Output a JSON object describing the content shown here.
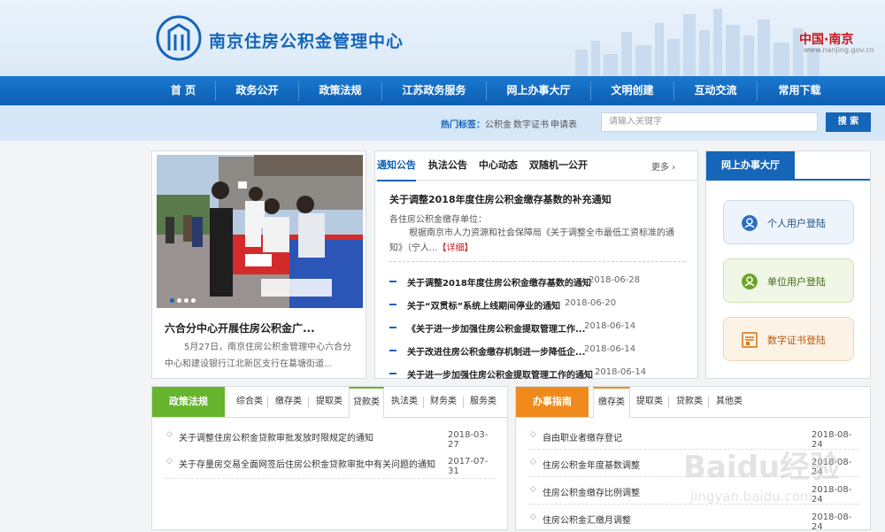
{
  "header": {
    "site_title": "南京住房公积金管理中心",
    "china_nanjing": "中国·南京",
    "nanjing_url": "www.nanjing.gov.cn"
  },
  "nav": {
    "items": [
      "首 页",
      "政务公开",
      "政策法规",
      "江苏政务服务",
      "网上办事大厅",
      "文明创建",
      "互动交流",
      "常用下载"
    ]
  },
  "search": {
    "hot_label": "热门标签：",
    "tags": [
      "公积金",
      "数字证书",
      "申请表"
    ],
    "placeholder": "请输入关键字",
    "button": "搜 索"
  },
  "carousel": {
    "headline": "六合分中心开展住房公积金广...",
    "summary": "5月27日，南京住房公积金管理中心六合分中心和建设银行江北新区支行在葛塘街道...",
    "active_slide": 1,
    "slide_count": 4
  },
  "notice": {
    "tabs": [
      "通知公告",
      "执法公告",
      "中心动态",
      "双随机一公开"
    ],
    "more": "更多 ›",
    "main_title": "关于调整2018年度住房公积金缴存基数的补充通知",
    "main_to": "各住房公积金缴存单位：",
    "main_body": "根据南京市人力资源和社会保障局《关于调整全市最低工资标准的通知》（宁人...",
    "detail": "【详细】",
    "items": [
      {
        "title": "关于调整2018年度住房公积金缴存基数的通知",
        "date": "2018-06-28"
      },
      {
        "title": "关于“双贯标”系统上线期间停业的通知",
        "date": "2018-06-20"
      },
      {
        "title": "《关于进一步加强住房公积金提取管理工作...",
        "date": "2018-06-14"
      },
      {
        "title": "关于改进住房公积金缴存机制进一步降低企...",
        "date": "2018-06-14"
      },
      {
        "title": "关于进一步加强住房公积金提取管理工作的通知",
        "date": "2018-06-14"
      }
    ]
  },
  "hall": {
    "header": "网上办事大厅",
    "buttons": [
      "个人用户登陆",
      "单位用户登陆",
      "数字证书登陆"
    ]
  },
  "policy": {
    "label": "政策法规",
    "tabs": [
      "综合类",
      "缴存类",
      "提取类",
      "贷款类",
      "执法类",
      "财务类",
      "服务类"
    ],
    "active_tab": "贷款类",
    "items": [
      {
        "title": "关于调整住房公积金贷款审批发放时限规定的通知",
        "date": "2018-03-27"
      },
      {
        "title": "关于存量房交易全面网签后住房公积金贷款审批中有关问题的通知",
        "date": "2017-07-31"
      }
    ]
  },
  "guide": {
    "label": "办事指南",
    "tabs": [
      "缴存类",
      "提取类",
      "贷款类",
      "其他类"
    ],
    "active_tab": "缴存类",
    "items": [
      {
        "title": "自由职业者缴存登记",
        "date": "2018-08-24"
      },
      {
        "title": "住房公积金年度基数调整",
        "date": "2018-08-24"
      },
      {
        "title": "住房公积金缴存比例调整",
        "date": "2018-08-24"
      },
      {
        "title": "住房公积金汇缴月调整",
        "date": "2018-08-24"
      }
    ]
  },
  "watermark": {
    "brand": "Baidu经验",
    "url": "jingyan.baidu.com"
  },
  "colors": {
    "nav_blue": "#1565b8",
    "policy_green": "#67b52d",
    "guide_orange": "#f08a1c",
    "highlight_red": "#c8161d"
  }
}
